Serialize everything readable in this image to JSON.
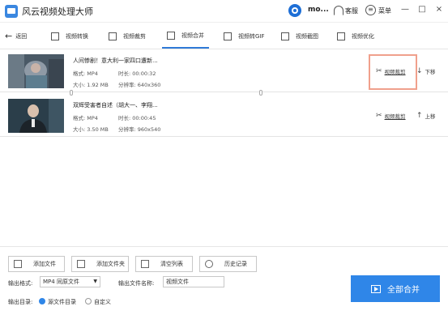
{
  "app": {
    "title": "风云视频处理大师"
  },
  "titlebar": {
    "user_name": "mo...",
    "service_label": "客服",
    "menu_label": "菜单",
    "minimize": "—",
    "maximize": "□",
    "close": "×"
  },
  "toolbar": {
    "back_label": "返回",
    "tabs": [
      {
        "label": "视频转换",
        "icon": "video-convert-icon"
      },
      {
        "label": "视频裁剪",
        "icon": "video-crop-icon"
      },
      {
        "label": "视频合并",
        "icon": "video-merge-icon",
        "active": true
      },
      {
        "label": "视频转GIF",
        "icon": "gif-icon"
      },
      {
        "label": "视频截图",
        "icon": "screenshot-icon"
      },
      {
        "label": "视频优化",
        "icon": "optimize-icon"
      }
    ]
  },
  "videos": [
    {
      "title": "人间惨剧！意大利一家四口遭新...",
      "format": "格式: MP4",
      "duration": "时长: 00:00:32",
      "size": "大小: 1.92 MB",
      "resolution": "分辨率: 640x360",
      "crop_label": "视频裁剪",
      "move_label": "下移"
    },
    {
      "title": "双辉受害者自述（胡大一、李翔...",
      "format": "格式: MP4",
      "duration": "时长: 00:00:45",
      "size": "大小: 3.50 MB",
      "resolution": "分辨率: 960x540",
      "crop_label": "视频裁剪",
      "move_label": "上移"
    }
  ],
  "bottom": {
    "add_file": "添加文件",
    "add_folder": "添加文件夹",
    "clear_list": "清空列表",
    "history": "历史记录",
    "output_format_label": "输出格式:",
    "output_format_value": "MP4 同原文件",
    "output_name_label": "输出文件名称:",
    "output_name_value": "视频文件",
    "output_dir_label": "输出目录:",
    "dir_option_source": "源文件目录",
    "dir_option_custom": "自定义",
    "merge_all": "全部合并"
  },
  "colors": {
    "accent": "#2f86e8",
    "highlight": "#f0a08c"
  }
}
